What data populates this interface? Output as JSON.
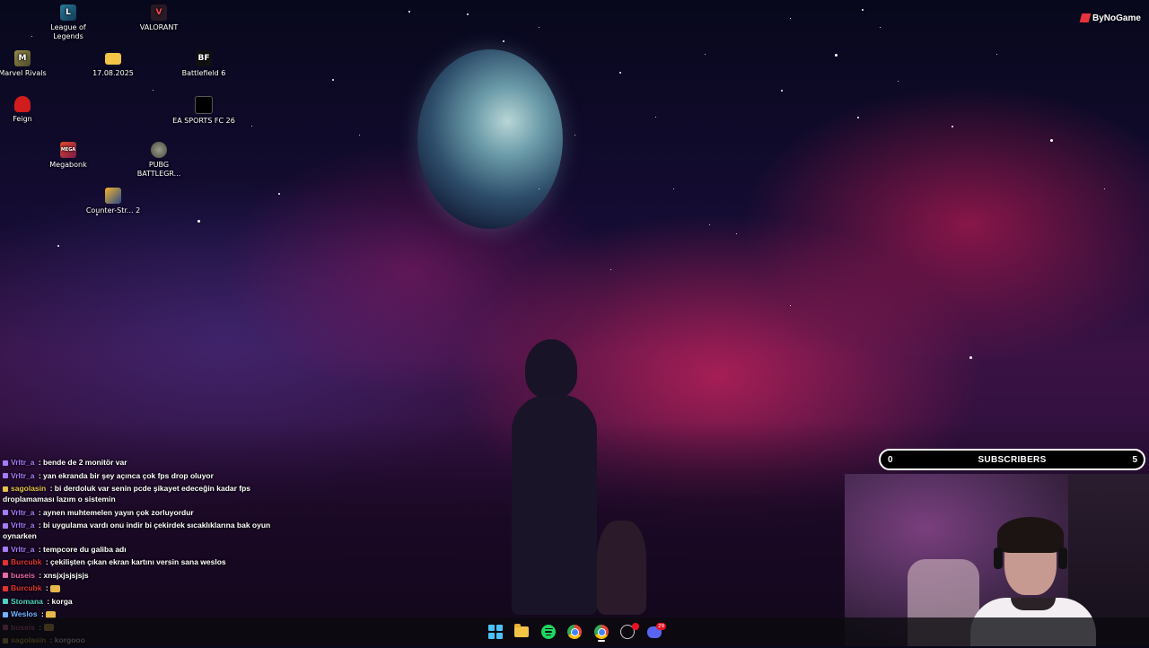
{
  "desktop": {
    "icons": [
      {
        "label": "League of Legends",
        "icon": "league-of-legends-icon",
        "color": "#1e5a7a"
      },
      {
        "label": "VALORANT",
        "icon": "valorant-icon",
        "color": "#b0233a"
      },
      {
        "label": "Marvel Rivals",
        "icon": "marvel-rivals-icon",
        "color": "#8a7a3a"
      },
      {
        "label": "17.08.2025",
        "icon": "folder-icon",
        "color": "#f3c446"
      },
      {
        "label": "Battlefield 6",
        "icon": "battlefield-icon",
        "color": "#222222"
      },
      {
        "label": "Feign",
        "icon": "feign-icon",
        "color": "#d01c1c"
      },
      {
        "label": "EA SPORTS FC 26",
        "icon": "ea-sports-fc-icon",
        "color": "#111111"
      },
      {
        "label": "Megabonk",
        "icon": "megabonk-icon",
        "color": "#c43a2a"
      },
      {
        "label": "PUBG BATTLEGR...",
        "icon": "pubg-icon",
        "color": "#6b6b55"
      },
      {
        "label": "Counter-Str... 2",
        "icon": "counter-strike-icon",
        "color": "#e9a21d"
      }
    ],
    "icon_glyphs": {
      "battlefield": "BF",
      "megabonk": "MEGA"
    }
  },
  "brand": {
    "text": "ByNoGame",
    "color": "#e8333a"
  },
  "chat": {
    "messages": [
      {
        "user": "Vrltr_a",
        "user_color": "#a67cff",
        "text": "bende de 2 monitör var",
        "emote": false
      },
      {
        "user": "Vrltr_a",
        "user_color": "#a67cff",
        "text": "yan ekranda bir şey açınca çok fps drop oluyor",
        "emote": false
      },
      {
        "user": "sagolasin",
        "user_color": "#e6c24a",
        "text": "bi derdoluk var senin pcde şikayet edeceğin kadar fps droplamaması lazım o sistemin",
        "emote": false
      },
      {
        "user": "Vrltr_a",
        "user_color": "#a67cff",
        "text": "aynen muhtemelen yayın çok zorluyordur",
        "emote": false
      },
      {
        "user": "Vrltr_a",
        "user_color": "#a67cff",
        "text": "bi uygulama vardı onu indir bi çekirdek sıcaklıklarına bak oyun oynarken",
        "emote": false
      },
      {
        "user": "Vrltr_a",
        "user_color": "#a67cff",
        "text": "tempcore du galiba adı",
        "emote": false
      },
      {
        "user": "Burcubk",
        "user_color": "#e0342e",
        "text": "çekilişten çıkan ekran kartını versin sana weslos",
        "emote": false
      },
      {
        "user": "buseis",
        "user_color": "#e86aa8",
        "text": "xnsjxjsjsjsjs",
        "emote": false
      },
      {
        "user": "Burcubk",
        "user_color": "#e0342e",
        "text": "",
        "emote": true
      },
      {
        "user": "Stomana",
        "user_color": "#4fd2c2",
        "text": "korga",
        "emote": false
      },
      {
        "user": "Weslos",
        "user_color": "#6fb4ff",
        "text": "",
        "emote": true
      },
      {
        "user": "buseis",
        "user_color": "#e86aa8",
        "text": "",
        "emote": true
      },
      {
        "user": "sagolasin",
        "user_color": "#e6c24a",
        "text": "korgooo",
        "emote": false
      }
    ],
    "separator": " : "
  },
  "subscribers": {
    "current": "0",
    "title": "SUBSCRIBERS",
    "goal": "5",
    "progress": 0.0
  },
  "taskbar": {
    "items": [
      "start-icon",
      "file-explorer-icon",
      "spotify-icon",
      "chrome-icon",
      "chrome-icon",
      "obs-icon",
      "discord-icon"
    ],
    "discord_badge": "29"
  }
}
